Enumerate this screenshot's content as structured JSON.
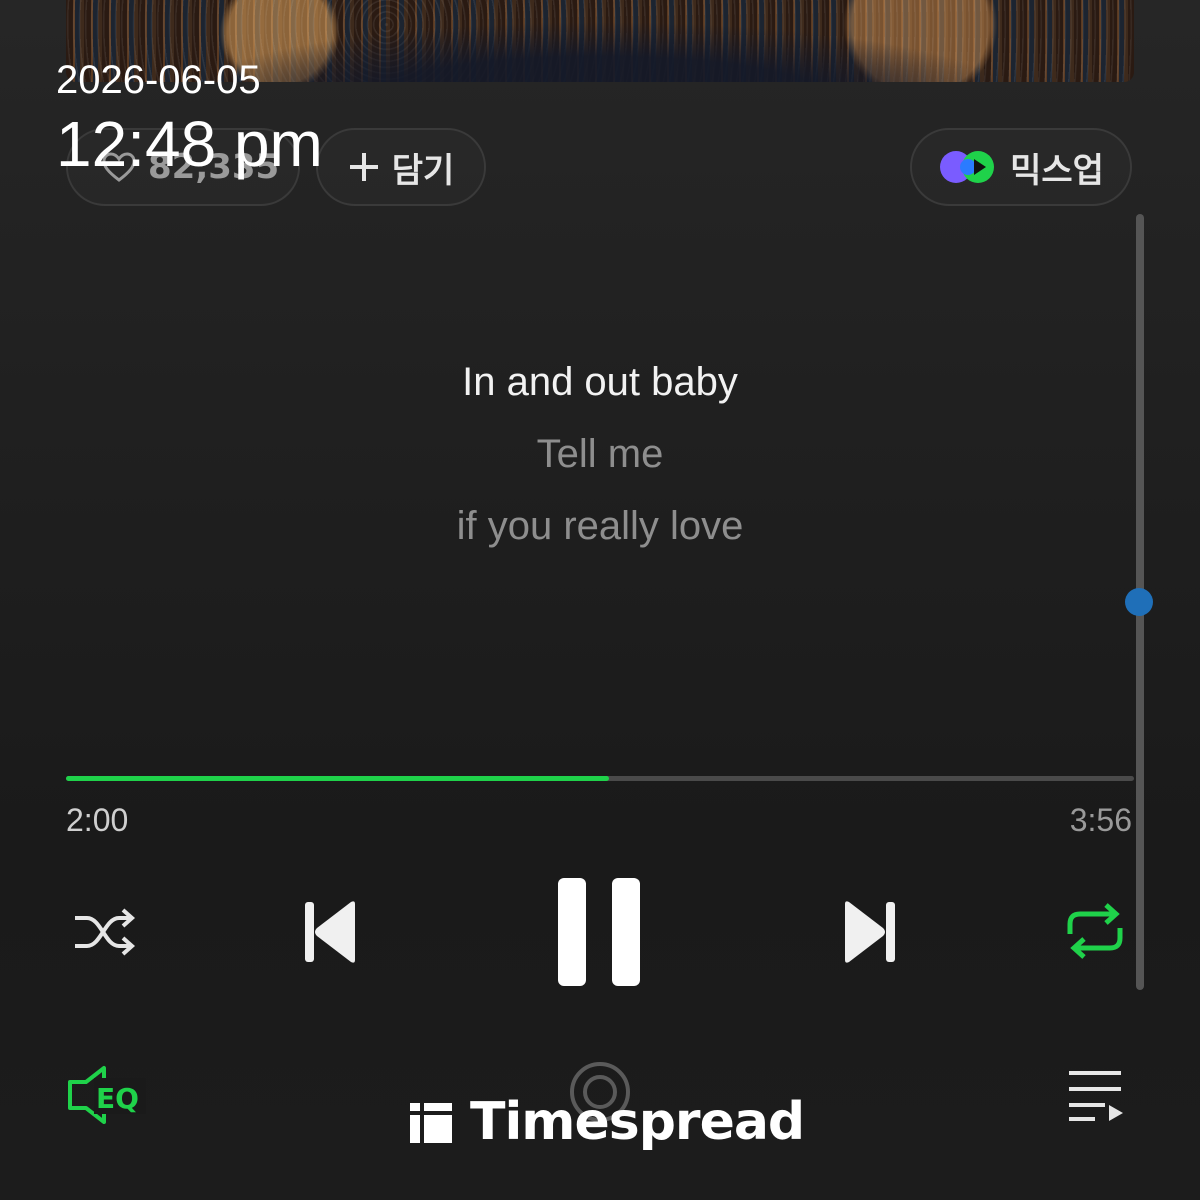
{
  "status_overlay": {
    "date": "2026-06-05",
    "time": "12:48 pm"
  },
  "actions": {
    "like_count": "82,335",
    "add_label": "담기",
    "mixup_label": "믹스업"
  },
  "lyrics": {
    "lines": [
      "In and out baby",
      "Tell me",
      "if you really love"
    ]
  },
  "playback": {
    "elapsed": "2:00",
    "total": "3:56",
    "progress_fraction": 0.5085,
    "state": "playing",
    "repeat": "on",
    "shuffle": "off"
  },
  "lyrics_scroll_fraction": 0.5,
  "bottom_bar": {
    "eq_label": "EQ"
  },
  "watermark": {
    "text": "Timespread"
  },
  "colors": {
    "accent": "#1fd24a",
    "scroll_knob": "#1f6fb8",
    "background": "#1f1f1f"
  },
  "icons": {
    "like": "heart-icon",
    "add": "plus-icon",
    "mixup": "mixup-icon",
    "shuffle": "shuffle-icon",
    "prev": "skip-previous-icon",
    "pause": "pause-icon",
    "next": "skip-next-icon",
    "repeat": "repeat-icon",
    "eq": "equalizer-icon",
    "cast": "cast-icon",
    "playlist": "playlist-icon",
    "logo": "timespread-logo-icon"
  }
}
